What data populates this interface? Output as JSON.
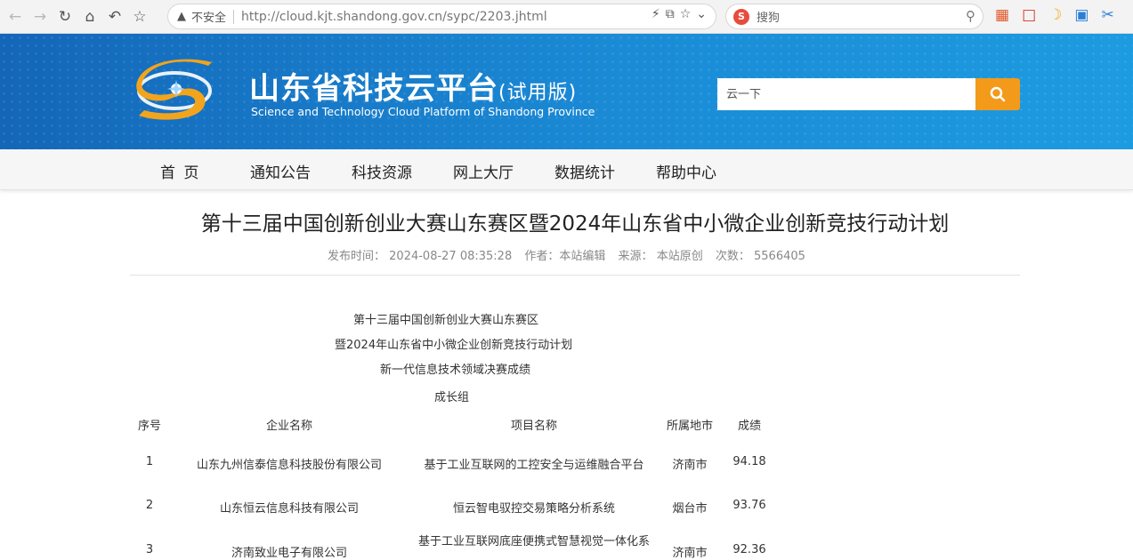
{
  "browser": {
    "insecure_label": "不安全",
    "url": "http://cloud.kjt.shandong.gov.cn/sypc/2203.jhtml",
    "search_engine_placeholder": "搜狗"
  },
  "site": {
    "title": "山东省科技云平台",
    "title_suffix": "(试用版)",
    "subtitle": "Science and Technology Cloud Platform of Shandong Province",
    "search_placeholder": "云一下",
    "colors": {
      "header_start": "#1466b8",
      "header_end": "#1d9be0",
      "search_button": "#f39a1b"
    }
  },
  "nav": {
    "items": [
      {
        "label": "首  页"
      },
      {
        "label": "通知公告"
      },
      {
        "label": "科技资源"
      },
      {
        "label": "网上大厅"
      },
      {
        "label": "数据统计"
      },
      {
        "label": "帮助中心"
      }
    ]
  },
  "article": {
    "title": "第十三届中国创新创业大赛山东赛区暨2024年山东省中小微企业创新竞技行动计划",
    "meta": {
      "publish_label": "发布时间：",
      "publish_time": "2024-08-27 08:35:28",
      "author_label": "作者：",
      "author": "本站编辑",
      "source_label": "来源：",
      "source": "本站原创",
      "views_label": "次数：",
      "views": "5566405"
    },
    "heading_lines": [
      "第十三届中国创新创业大赛山东赛区",
      "暨2024年山东省中小微企业创新竞技行动计划",
      "新一代信息技术领域决赛成绩",
      "成长组"
    ],
    "table": {
      "headers": [
        "序号",
        "企业名称",
        "项目名称",
        "所属地市",
        "成绩"
      ],
      "rows": [
        {
          "no": "1",
          "company": "山东九州信泰信息科技股份有限公司",
          "project": "基于工业互联网的工控安全与运维融合平台",
          "city": "济南市",
          "score": "94.18"
        },
        {
          "no": "2",
          "company": "山东恒云信息科技有限公司",
          "project": "恒云智电驭控交易策略分析系统",
          "city": "烟台市",
          "score": "93.76"
        },
        {
          "no": "3",
          "company": "济南致业电子有限公司",
          "project": "基于工业互联网底座便携式智慧视觉一体化系",
          "city": "济南市",
          "score": "92.36"
        }
      ]
    }
  }
}
